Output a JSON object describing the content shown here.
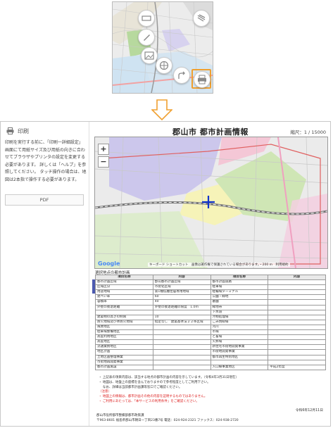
{
  "sidebar": {
    "title": "印刷",
    "instructions": "印刷を実行する前に、「印刷一詳細設定」画面にて用紙サイズ及び用紙の向きに合わせてブラウザやプリンタの設定を変更する必要があります。 詳しくは「ヘルプ」を参照してください。 タッチ操作の場合は、地図は2本指で操作する必要があります。",
    "pdf_button": "PDF"
  },
  "page": {
    "title": "郡山市 都市計画情報",
    "scale": "縮尺：1 / 15000",
    "map_footer": "キーボード ショートカット　画像は著作権で保護されている場合があります。・200 m　利用規約",
    "google": "Google",
    "point_caption": "選択地点の都市計画",
    "table_headers": [
      "項目名称",
      "内容",
      "項目名称",
      "内容"
    ],
    "table_rows": [
      [
        "都市計画区域",
        "郡山都市計画区域",
        "都市計画道路",
        ""
      ],
      [
        "区域区分",
        "市街化区域",
        "駐車場",
        ""
      ],
      [
        "用途地域",
        "第1種低層住居専用地域",
        "駐輪場ターミナル",
        ""
      ],
      [
        "建ぺい率",
        "60",
        "公園・緑地",
        ""
      ],
      [
        "容積率",
        "40",
        "墓園",
        ""
      ],
      [
        "外壁の後退距離",
        "外壁の後退距離の限度　1.0m",
        "緑地帯",
        ""
      ],
      [
        "",
        "",
        "下水道",
        ""
      ],
      [
        "建築物の高さの制限",
        "10",
        "汚物処理場",
        ""
      ],
      [
        "防火地域及び準防火地域",
        "指定なし　建築基準法２２条区域",
        "ごみ焼却場",
        ""
      ],
      [
        "風致地区",
        "",
        "河川",
        ""
      ],
      [
        "駐車場整備地区",
        "",
        "市場",
        ""
      ],
      [
        "高度利用地区",
        "",
        "と畜場",
        ""
      ],
      [
        "高度地区",
        "",
        "火葬場",
        ""
      ],
      [
        "流通業務地区",
        "",
        "新住宅市街地開発事業",
        ""
      ],
      [
        "地区計画",
        "",
        "市街地開発事業",
        ""
      ],
      [
        "土地区画整理事業",
        "",
        "都市再生特別地区",
        ""
      ],
      [
        "市街地再開発事業",
        "",
        "",
        ""
      ],
      [
        "都市計画施設",
        "",
        "入口線事業地区",
        "平成2年度"
      ]
    ],
    "notes": [
      "・ 上記表の項目内容は、該当する地点の都市計画の内容を示しています。（令和4年3月31日現在）",
      "・ 地図は、地盤上の座標を含んでおりますので参考程度としてご利用下さい。",
      "　 なお、詳細は当該都市計画課等窓口でご確認ください。",
      "（注意）",
      "・ 地図上の情報は、都市計画その他の内容を証明するものではありません。",
      "・ ご利用にあたっては、「本サービスの利用条件」をご確認ください。"
    ],
    "date": "令和6年12月11日",
    "footer_lines": [
      "郡山市役所都市整備部都市政策課",
      "〒963-8601 福島県郡山市朝日一丁目23番7号 電話：024-924-2321 ファックス：024-938-2720"
    ]
  },
  "icons": {
    "top_menu": [
      "ruler-icon",
      "measure-icon",
      "pencil-icon",
      "image-icon",
      "globe-icon",
      "share-icon",
      "print-icon",
      "hamburger-icon"
    ],
    "highlight": "#f0a030",
    "accent": "#4c5ab0"
  }
}
